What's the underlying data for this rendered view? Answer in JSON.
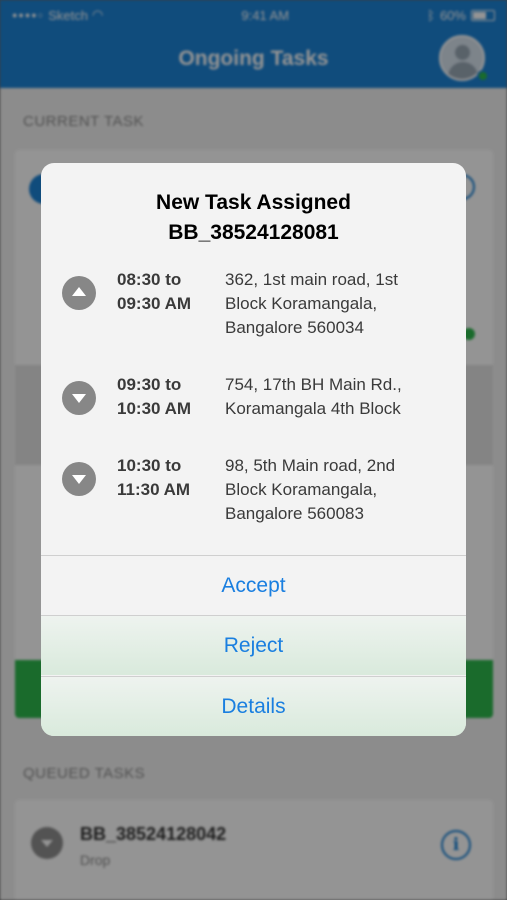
{
  "status_bar": {
    "carrier": "Sketch",
    "time": "9:41 AM",
    "battery": "60%"
  },
  "nav": {
    "title": "Ongoing Tasks"
  },
  "sections": {
    "current": "CURRENT TASK",
    "queued": "QUEUED TASKS"
  },
  "queued_task": {
    "id": "BB_38524128042",
    "type": "Drop"
  },
  "modal": {
    "title_line1": "New Task Assigned",
    "title_line2": "BB_38524128081",
    "tasks": [
      {
        "direction": "up",
        "time": "08:30 to\n09:30 AM",
        "address": "362, 1st main road, 1st Block Koramangala, Bangalore 560034"
      },
      {
        "direction": "down",
        "time": "09:30 to\n10:30 AM",
        "address": "754, 17th BH Main Rd., Koramangala 4th Block"
      },
      {
        "direction": "down",
        "time": "10:30 to\n11:30 AM",
        "address": "98, 5th Main road, 2nd Block Koramangala, Bangalore 560083"
      }
    ],
    "actions": {
      "accept": "Accept",
      "reject": "Reject",
      "details": "Details"
    }
  },
  "colors": {
    "brand_blue": "#1c83d6",
    "action_blue": "#1a7fe0",
    "success_green": "#2db84d"
  }
}
